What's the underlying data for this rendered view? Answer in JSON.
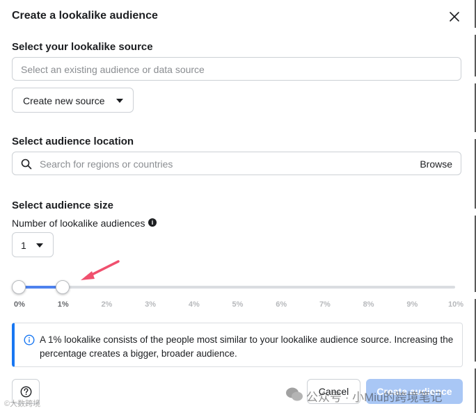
{
  "dialog": {
    "title": "Create a lookalike audience"
  },
  "source": {
    "label": "Select your lookalike source",
    "placeholder": "Select an existing audience or data source",
    "create_button": "Create new source"
  },
  "location": {
    "label": "Select audience location",
    "placeholder": "Search for regions or countries",
    "browse": "Browse"
  },
  "size": {
    "label": "Select audience size",
    "count_label": "Number of lookalike audiences",
    "count_value": "1",
    "slider": {
      "range_start_percent": 0,
      "range_end_percent": 1,
      "max_percent": 10,
      "ticks": [
        "0%",
        "1%",
        "2%",
        "3%",
        "4%",
        "5%",
        "6%",
        "7%",
        "8%",
        "9%",
        "10%"
      ],
      "fill_color": "#4e82ee"
    }
  },
  "info": {
    "text": "A 1% lookalike consists of the people most similar to your lookalike audience source. Increasing the percentage creates a bigger, broader audience."
  },
  "footer": {
    "cancel": "Cancel",
    "continue_text": "Create audience"
  },
  "watermark": {
    "right": "公众号 · 小Miu的跨境笔记",
    "left": "©大数跨境"
  },
  "colors": {
    "accent": "#1877f2",
    "arrow": "#f0506e"
  }
}
